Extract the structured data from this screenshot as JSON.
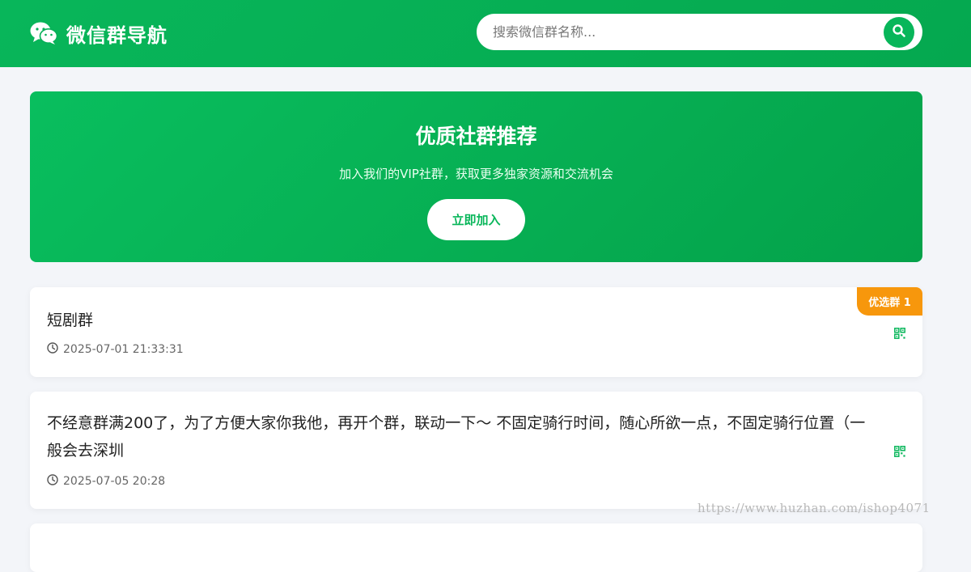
{
  "header": {
    "brand_icon": "wechat-icon",
    "brand_name": "微信群导航",
    "search": {
      "placeholder": "搜索微信群名称...",
      "value": "",
      "button_icon": "search-icon"
    }
  },
  "banner": {
    "title": "优质社群推荐",
    "subtitle": "加入我们的VIP社群，获取更多独家资源和交流机会",
    "button_label": "立即加入"
  },
  "groups": [
    {
      "title": "短剧群",
      "time": "2025-07-01 21:33:31",
      "badge": "优选群 1",
      "qr_icon": "qrcode-icon"
    },
    {
      "title": "不经意群满200了，为了方便大家你我他，再开个群，联动一下～ 不固定骑行时间，随心所欲一点，不固定骑行位置（一般会去深圳",
      "time": "2025-07-05 20:28",
      "qr_icon": "qrcode-icon"
    }
  ],
  "watermark": "https://www.huzhan.com/ishop4071",
  "colors": {
    "brand_green": "#08b65a",
    "badge_orange": "#f7970c",
    "page_bg": "#f3f5f9"
  }
}
